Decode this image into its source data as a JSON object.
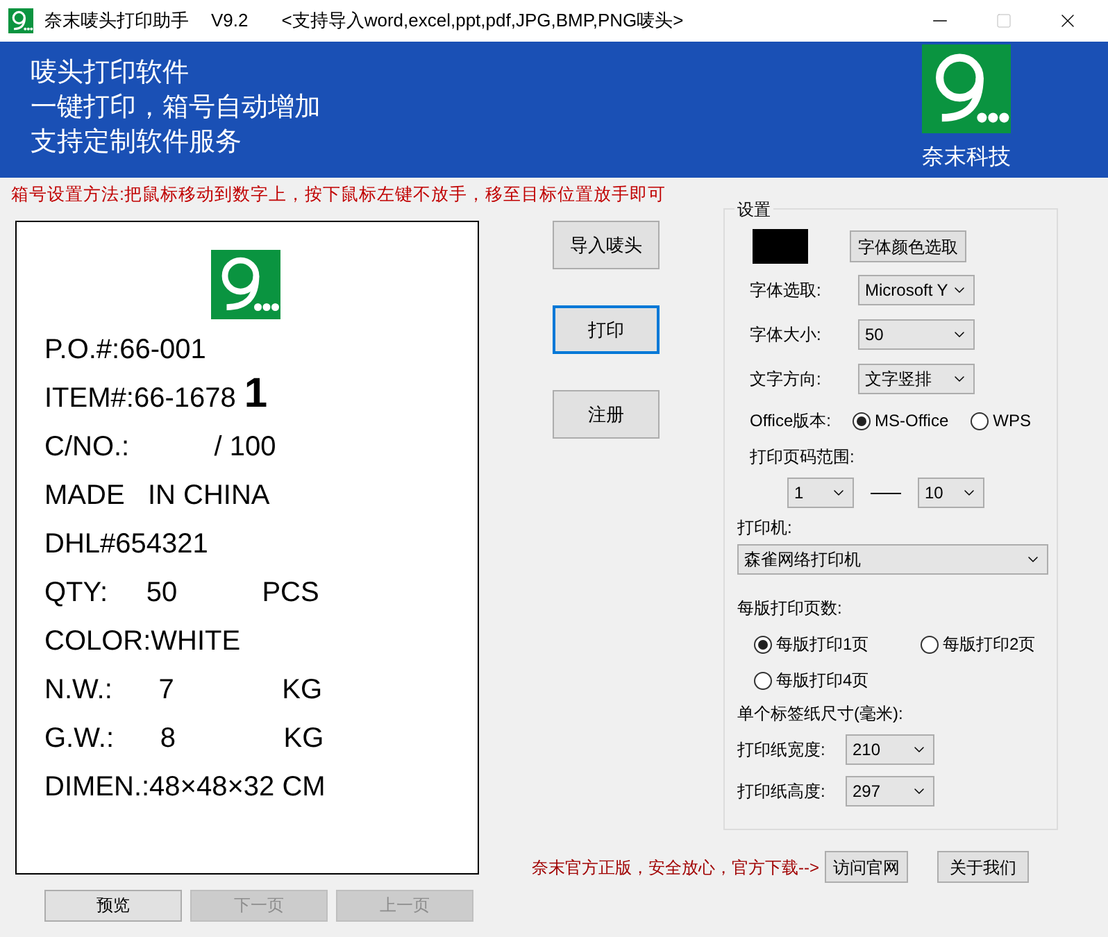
{
  "window": {
    "title": "奈末唛头打印助手",
    "version": "V9.2",
    "subtitle": "<支持导入word,excel,ppt,pdf,JPG,BMP,PNG唛头>"
  },
  "banner": {
    "lines": [
      "唛头打印软件",
      "一键打印，箱号自动增加",
      "支持定制软件服务"
    ],
    "company": "奈末科技"
  },
  "hint": "箱号设置方法:把鼠标移动到数字上，按下鼠标左键不放手，移至目标位置放手即可",
  "label": {
    "lines": [
      {
        "text": "P.O.#:66-001"
      },
      {
        "text": "ITEM#:66-1678",
        "number": "1"
      },
      {
        "text": "C/NO.:           / 100"
      },
      {
        "text": "MADE   IN CHINA"
      },
      {
        "text": "DHL#654321"
      },
      {
        "text": "QTY:     50           PCS"
      },
      {
        "text": "COLOR:WHITE"
      },
      {
        "text": "N.W.:      7              KG"
      },
      {
        "text": "G.W.:      8              KG"
      },
      {
        "text": "DIMEN.:48×48×32 CM"
      }
    ]
  },
  "actions": [
    {
      "label": "导入唛头",
      "selected": false
    },
    {
      "label": "打印",
      "selected": true
    },
    {
      "label": "注册",
      "selected": false
    }
  ],
  "preview_buttons": [
    {
      "label": "预览",
      "disabled": false
    },
    {
      "label": "下一页",
      "disabled": true
    },
    {
      "label": "上一页",
      "disabled": true
    }
  ],
  "settings": {
    "title": "设置",
    "swatch": {
      "color": "#000000"
    },
    "color_button": "字体颜色选取",
    "dropdowns": [
      {
        "label": "字体选取:",
        "value": "Microsoft Y"
      },
      {
        "label": "字体大小:",
        "value": "50"
      },
      {
        "label": "文字方向:",
        "value": "文字竖排"
      }
    ],
    "office": {
      "label": "Office版本:",
      "options": [
        {
          "label": "MS-Office",
          "selected": true
        },
        {
          "label": "WPS",
          "selected": false
        }
      ]
    },
    "page_range": {
      "label": "打印页码范围:",
      "from": "1",
      "to": "10"
    },
    "printer": {
      "label": "打印机:",
      "value": "森雀网络打印机"
    },
    "per_sheet": {
      "label": "每版打印页数:",
      "options": [
        {
          "label": "每版打印1页",
          "selected": true
        },
        {
          "label": "每版打印2页",
          "selected": false
        },
        {
          "label": "每版打印4页",
          "selected": false
        }
      ]
    },
    "paper": {
      "label": "单个标签纸尺寸(毫米):",
      "fields": [
        {
          "label": "打印纸宽度:",
          "value": "210"
        },
        {
          "label": "打印纸高度:",
          "value": "297"
        }
      ]
    }
  },
  "footer": {
    "text": "奈末官方正版，安全放心，官方下载-->",
    "buttons": [
      "访问官网",
      "关于我们"
    ]
  }
}
